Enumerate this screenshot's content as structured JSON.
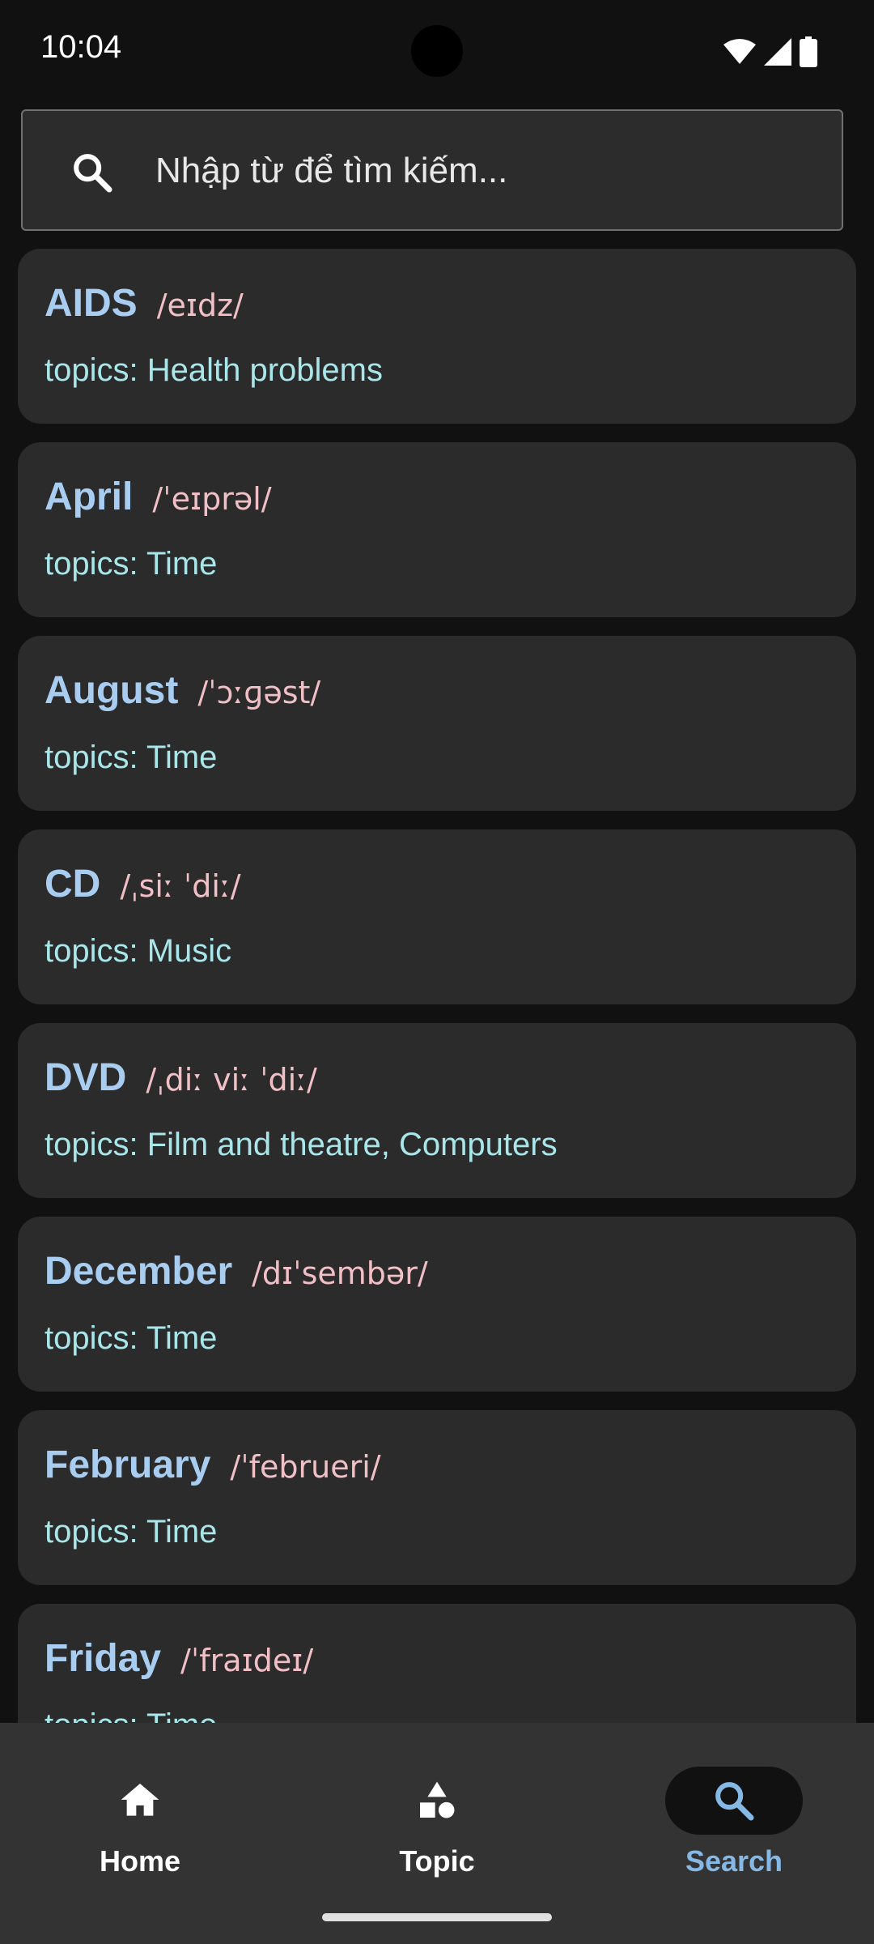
{
  "status_bar": {
    "time": "10:04",
    "icons": [
      "wifi-icon",
      "cell-signal-icon",
      "battery-icon"
    ]
  },
  "search": {
    "placeholder": "Nhập từ để tìm kiếm...",
    "value": "",
    "icon": "search-icon"
  },
  "results": [
    {
      "word": "AIDS",
      "ipa": "/eɪdz/",
      "topics": "topics: Health problems"
    },
    {
      "word": "April",
      "ipa": "/ˈeɪprəl/",
      "topics": "topics: Time"
    },
    {
      "word": "August",
      "ipa": "/ˈɔːɡəst/",
      "topics": "topics: Time"
    },
    {
      "word": "CD",
      "ipa": "/ˌsiː ˈdiː/",
      "topics": "topics: Music"
    },
    {
      "word": "DVD",
      "ipa": "/ˌdiː viː ˈdiː/",
      "topics": "topics: Film and theatre, Computers"
    },
    {
      "word": "December",
      "ipa": "/dɪˈsembər/",
      "topics": "topics: Time"
    },
    {
      "word": "February",
      "ipa": "/ˈfebrueri/",
      "topics": "topics: Time"
    },
    {
      "word": "Friday",
      "ipa": "/ˈfraɪdeɪ/",
      "topics": "topics: Time"
    }
  ],
  "bottom_nav": {
    "items": [
      {
        "label": "Home",
        "icon": "home-icon",
        "active": false
      },
      {
        "label": "Topic",
        "icon": "shapes-icon",
        "active": false
      },
      {
        "label": "Search",
        "icon": "search-icon",
        "active": true
      }
    ]
  },
  "colors": {
    "background": "#111111",
    "card": "#2b2b2b",
    "word": "#a9cdf0",
    "ipa": "#f1c0c6",
    "topics": "#a8e6ea",
    "nav_bar": "#333333",
    "active_nav": "#86b8e6"
  }
}
